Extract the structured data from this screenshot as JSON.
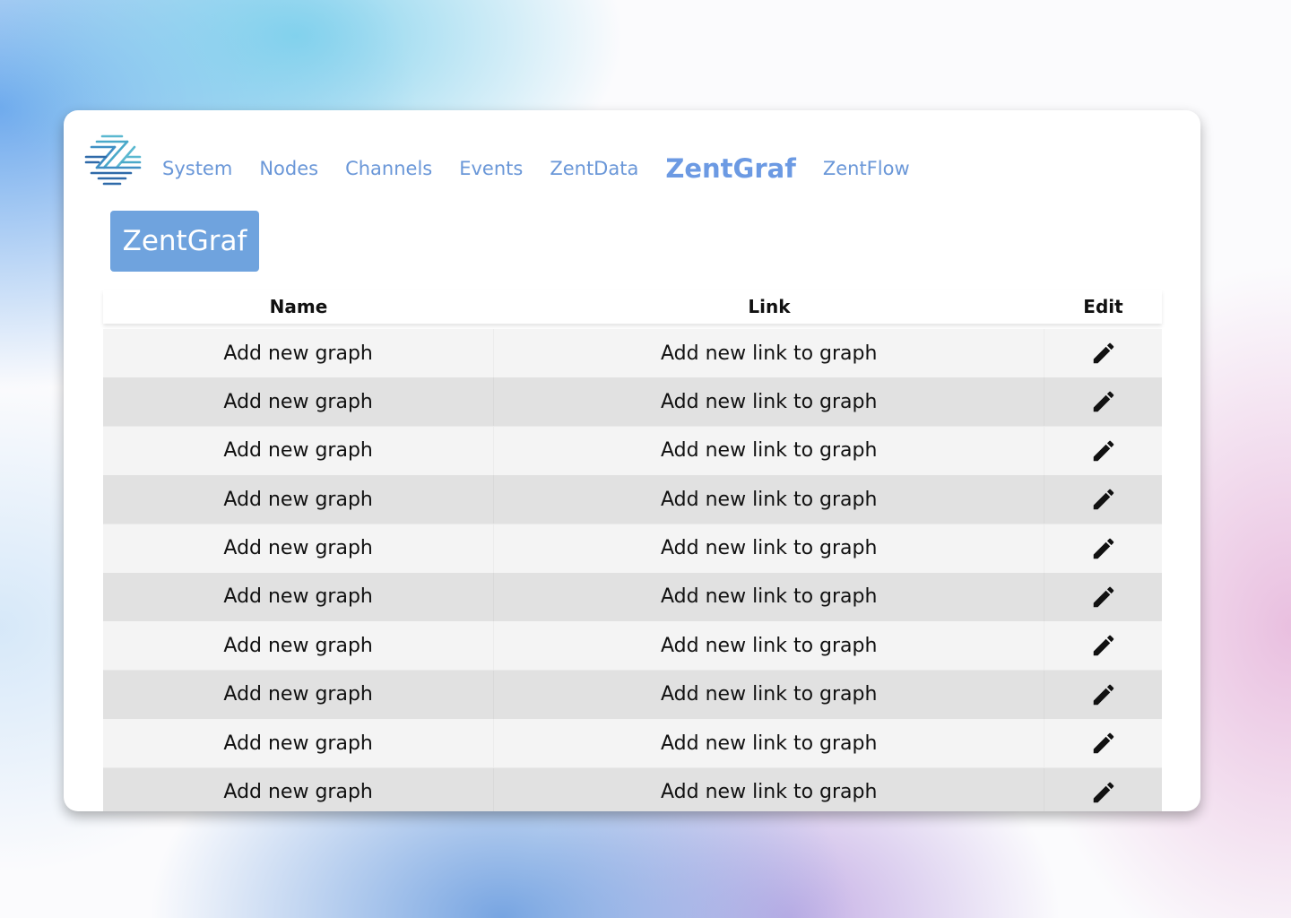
{
  "nav": {
    "logo_icon": "zentrix-logo-icon",
    "items": [
      {
        "label": "System",
        "active": false
      },
      {
        "label": "Nodes",
        "active": false
      },
      {
        "label": "Channels",
        "active": false
      },
      {
        "label": "Events",
        "active": false
      },
      {
        "label": "ZentData",
        "active": false
      },
      {
        "label": "ZentGraf",
        "active": true
      },
      {
        "label": "ZentFlow",
        "active": false
      }
    ]
  },
  "page": {
    "title": "ZentGraf"
  },
  "table": {
    "headers": {
      "name": "Name",
      "link": "Link",
      "edit": "Edit"
    },
    "edit_icon": "pencil-icon",
    "rows": [
      {
        "name": "Add new graph",
        "link": "Add new link to graph"
      },
      {
        "name": "Add new graph",
        "link": "Add new link to graph"
      },
      {
        "name": "Add new graph",
        "link": "Add new link to graph"
      },
      {
        "name": "Add new graph",
        "link": "Add new link to graph"
      },
      {
        "name": "Add new graph",
        "link": "Add new link to graph"
      },
      {
        "name": "Add new graph",
        "link": "Add new link to graph"
      },
      {
        "name": "Add new graph",
        "link": "Add new link to graph"
      },
      {
        "name": "Add new graph",
        "link": "Add new link to graph"
      },
      {
        "name": "Add new graph",
        "link": "Add new link to graph"
      },
      {
        "name": "Add new graph",
        "link": "Add new link to graph"
      }
    ]
  },
  "colors": {
    "nav_text": "#6a97d8",
    "badge_bg": "#6fa3de",
    "row_light": "#f4f4f4",
    "row_dark": "#e1e1e1"
  }
}
